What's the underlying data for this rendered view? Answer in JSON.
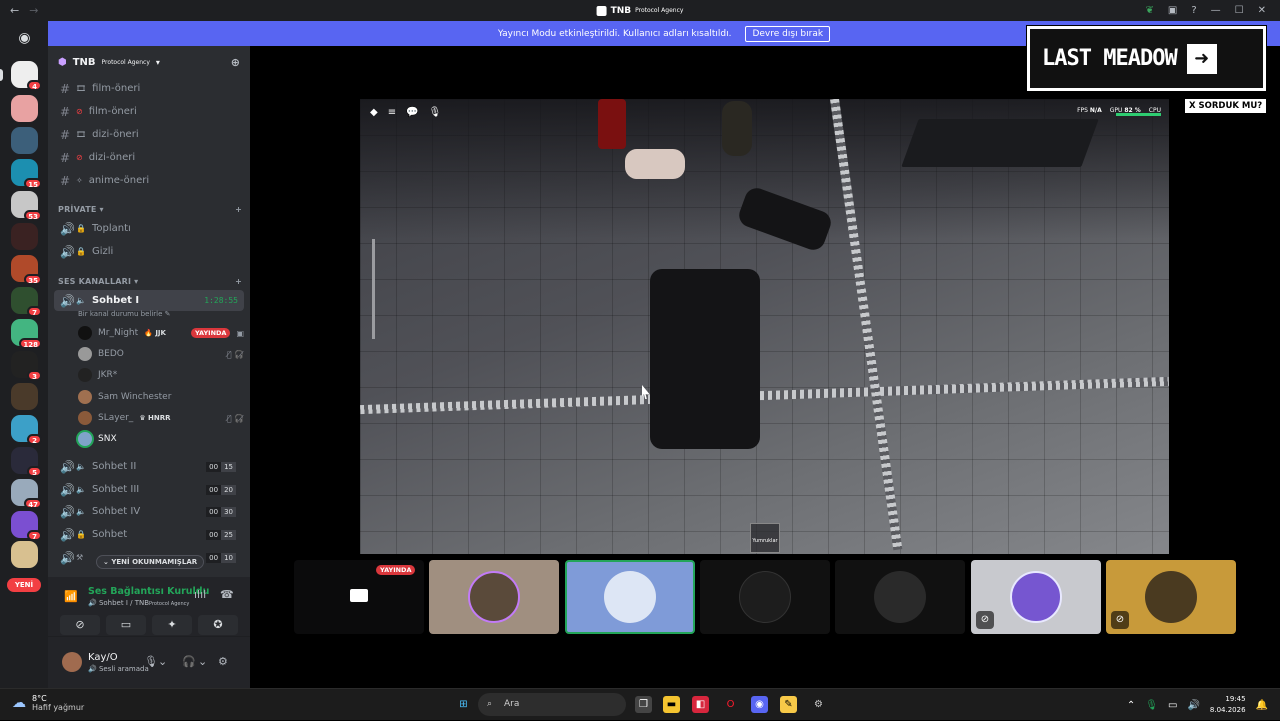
{
  "titlebar": {
    "app_name": "TNB",
    "app_sub": "Protocol Agency"
  },
  "banner": {
    "message": "Yayıncı Modu etkinleştirildi. Kullanıcı adları kısaltıldı.",
    "button": "Devre dışı bırak"
  },
  "guild_badges": [
    "4",
    "15",
    "53",
    "35",
    "7",
    "128",
    "3",
    "2",
    "5",
    "47",
    "7"
  ],
  "yeni_pill": "YENİ",
  "server": {
    "name": "TNB",
    "name_sub": "Protocol Agency"
  },
  "text_channels": [
    "film-öneri",
    "film-öneri",
    "dizi-öneri",
    "dizi-öneri",
    "anime-öneri"
  ],
  "categories": {
    "private": "PRİVATE",
    "voice": "SES KANALLARI"
  },
  "private_channels": [
    "Toplantı",
    "Gizli"
  ],
  "active_voice": {
    "name": "Sohbet I",
    "timer": "1:28:55",
    "status": "Bir kanal durumu belirle"
  },
  "voice_users": [
    {
      "name": "Mr_Night",
      "tag": "JJK",
      "live": "YAYINDA"
    },
    {
      "name": "BEDO",
      "tag": "",
      "live": ""
    },
    {
      "name": "JKR*",
      "tag": "",
      "live": ""
    },
    {
      "name": "Sam Winchester",
      "tag": "",
      "live": ""
    },
    {
      "name": "SLayer_",
      "tag": "HNRR",
      "live": ""
    },
    {
      "name": "SNX",
      "tag": "",
      "live": ""
    }
  ],
  "voice_channels": [
    {
      "name": "Sohbet II",
      "a": "00",
      "b": "15"
    },
    {
      "name": "Sohbet III",
      "a": "00",
      "b": "20"
    },
    {
      "name": "Sohbet IV",
      "a": "00",
      "b": "30"
    },
    {
      "name": "Sohbet",
      "a": "00",
      "b": "25"
    },
    {
      "name": "",
      "a": "00",
      "b": "10"
    }
  ],
  "unread_pill": "YENİ OKUNMAMIŞLAR",
  "voice_panel": {
    "status": "Ses Bağlantısı Kuruldu",
    "channel": "Sohbet I / TNB",
    "channel_sub": "Protocol Agency"
  },
  "user_panel": {
    "name": "Kay/O",
    "status": "Sesli aramada"
  },
  "stream": {
    "hud": {
      "fps_label": "FPS",
      "fps": "N/A",
      "gpu_label": "GPU",
      "gpu": "82 %",
      "cpu_label": "CPU"
    },
    "tool_label": "Yumruklar"
  },
  "overlay": {
    "last_meadow": "LAST MEADOW",
    "sorduk": "X SORDUK MU?"
  },
  "tiles": {
    "live_label": "YAYINDA"
  },
  "taskbar": {
    "temp": "8°C",
    "weather": "Hafif yağmur",
    "search_placeholder": "Ara",
    "time": "19:45",
    "date": "8.04.2026"
  },
  "colors": {
    "accent": "#5865f2",
    "green": "#23a559",
    "red": "#da373c"
  }
}
